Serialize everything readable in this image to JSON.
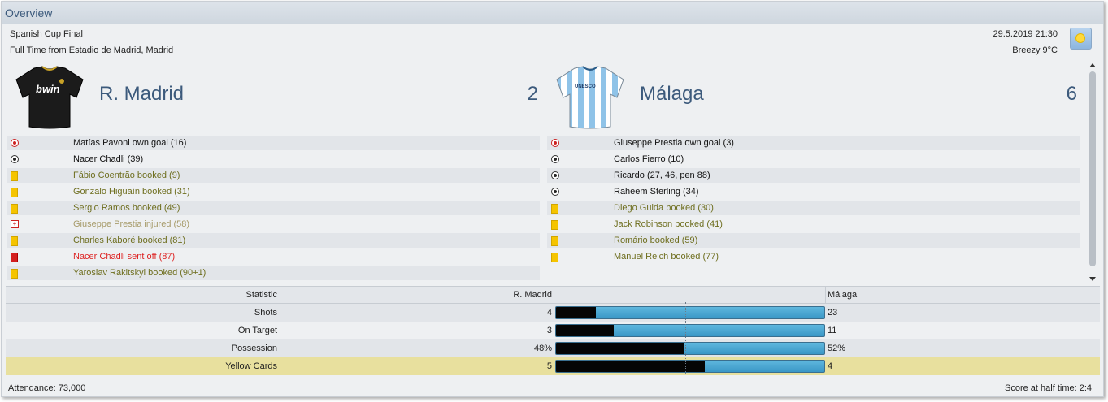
{
  "header": {
    "title": "Overview"
  },
  "match": {
    "competition": "Spanish Cup Final",
    "venue": "Full Time from Estadio de Madrid, Madrid",
    "datetime": "29.5.2019 21:30",
    "weather": "Breezy 9°C",
    "weather_icon": "sun-icon"
  },
  "home": {
    "name": "R. Madrid",
    "score": "2",
    "shirt_sponsor": "bwin",
    "events": [
      {
        "type": "own-goal",
        "text": "Matías Pavoni own goal (16)"
      },
      {
        "type": "goal",
        "text": "Nacer Chadli (39)"
      },
      {
        "type": "yellow",
        "text": "Fábio Coentrão booked (9)"
      },
      {
        "type": "yellow",
        "text": "Gonzalo Higuaín booked (31)"
      },
      {
        "type": "yellow",
        "text": "Sergio Ramos booked (49)"
      },
      {
        "type": "injury",
        "text": "Giuseppe Prestia injured (58)"
      },
      {
        "type": "yellow",
        "text": "Charles Kaboré booked (81)"
      },
      {
        "type": "red",
        "text": "Nacer Chadli sent off (87)"
      },
      {
        "type": "yellow",
        "text": "Yaroslav Rakitskyi booked (90+1)"
      }
    ]
  },
  "away": {
    "name": "Málaga",
    "score": "6",
    "shirt_sponsor": "UNESCO",
    "events": [
      {
        "type": "own-goal",
        "text": "Giuseppe Prestia own goal (3)"
      },
      {
        "type": "goal",
        "text": "Carlos Fierro (10)"
      },
      {
        "type": "goal",
        "text": "Ricardo (27, 46, pen 88)"
      },
      {
        "type": "goal",
        "text": "Raheem Sterling (34)"
      },
      {
        "type": "yellow",
        "text": "Diego Guida booked (30)"
      },
      {
        "type": "yellow",
        "text": "Jack Robinson booked (41)"
      },
      {
        "type": "yellow",
        "text": "Romário booked (59)"
      },
      {
        "type": "yellow",
        "text": "Manuel Reich booked (77)"
      }
    ]
  },
  "stats": {
    "header": {
      "label": "Statistic",
      "home": "R. Madrid",
      "away": "Málaga"
    },
    "rows": [
      {
        "label": "Shots",
        "home": "4",
        "away": "23",
        "home_share": 0.148
      },
      {
        "label": "On Target",
        "home": "3",
        "away": "11",
        "home_share": 0.214
      },
      {
        "label": "Possession",
        "home": "48%",
        "away": "52%",
        "home_share": 0.48
      },
      {
        "label": "Yellow Cards",
        "home": "5",
        "away": "4",
        "home_share": 0.556
      }
    ]
  },
  "footer": {
    "attendance": "Attendance: 73,000",
    "halftime": "Score at half time: 2:4"
  },
  "colors": {
    "title": "#3c5a7c",
    "booked_text": "#6e6e1e",
    "red_text": "#dd2222",
    "highlight_row": "#e8e09e",
    "bar_away": "#3a97c6",
    "bar_home": "#050505"
  }
}
